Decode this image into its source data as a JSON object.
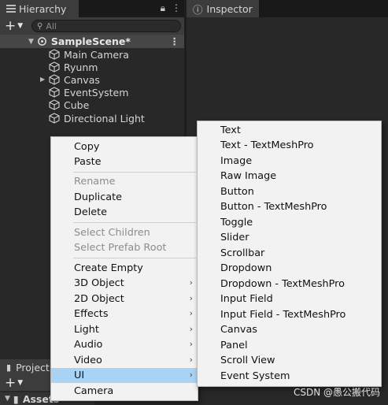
{
  "hierarchy": {
    "tab_title": "Hierarchy",
    "search_placeholder": "All",
    "scene_name": "SampleScene*",
    "items": [
      {
        "label": "Main Camera"
      },
      {
        "label": "Ryunm"
      },
      {
        "label": "Canvas"
      },
      {
        "label": "EventSystem"
      },
      {
        "label": "Cube"
      },
      {
        "label": "Directional Light"
      }
    ]
  },
  "inspector": {
    "tab_title": "Inspector"
  },
  "project": {
    "tab_title": "Project",
    "assets_label": "Assets"
  },
  "context_menu": {
    "copy": "Copy",
    "paste": "Paste",
    "rename": "Rename",
    "duplicate": "Duplicate",
    "delete": "Delete",
    "select_children": "Select Children",
    "select_prefab_root": "Select Prefab Root",
    "create_empty": "Create Empty",
    "obj3d": "3D Object",
    "obj2d": "2D Object",
    "effects": "Effects",
    "light": "Light",
    "audio": "Audio",
    "video": "Video",
    "ui": "UI",
    "camera": "Camera"
  },
  "ui_submenu": {
    "items": [
      "Text",
      "Text - TextMeshPro",
      "Image",
      "Raw Image",
      "Button",
      "Button - TextMeshPro",
      "Toggle",
      "Slider",
      "Scrollbar",
      "Dropdown",
      "Dropdown - TextMeshPro",
      "Input Field",
      "Input Field - TextMeshPro",
      "Canvas",
      "Panel",
      "Scroll View",
      "Event System"
    ]
  },
  "watermark": "CSDN @愚公搬代码",
  "colors": {
    "menu_highlight": "#a9d3f4",
    "panel_bg": "#282828",
    "menu_bg": "#f2f2f2"
  }
}
